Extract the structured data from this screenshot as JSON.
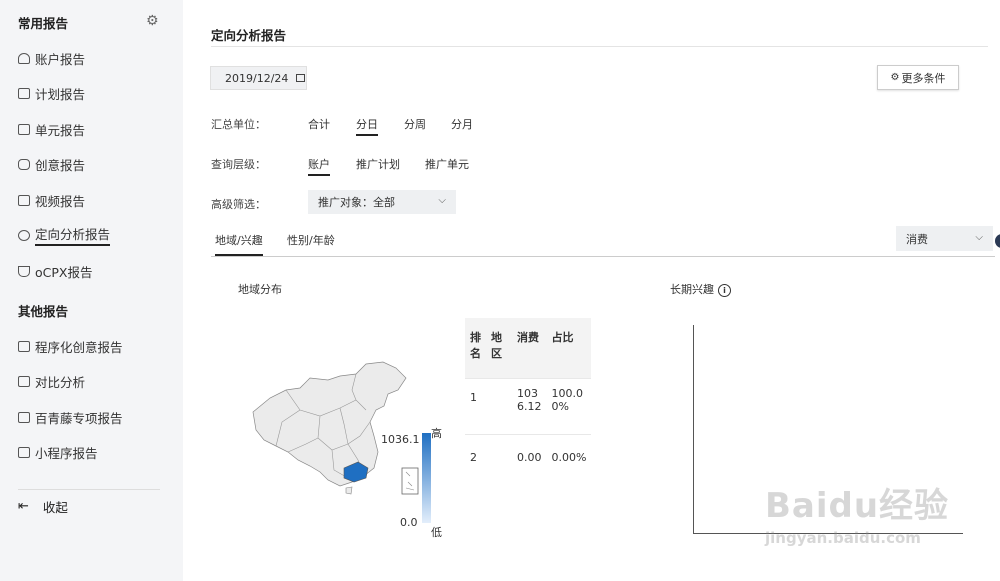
{
  "sidebar": {
    "common_title": "常用报告",
    "common_items": [
      {
        "label": "账户报告",
        "icon": "user-icon"
      },
      {
        "label": "计划报告",
        "icon": "plan-icon"
      },
      {
        "label": "单元报告",
        "icon": "unit-icon"
      },
      {
        "label": "创意报告",
        "icon": "creative-icon"
      },
      {
        "label": "视频报告",
        "icon": "video-icon"
      },
      {
        "label": "定向分析报告",
        "icon": "target-icon",
        "active": true
      },
      {
        "label": "oCPX报告",
        "icon": "ocpx-icon"
      }
    ],
    "other_title": "其他报告",
    "other_items": [
      {
        "label": "程序化创意报告",
        "icon": "programmatic-icon"
      },
      {
        "label": "对比分析",
        "icon": "compare-icon"
      },
      {
        "label": "百青藤专项报告",
        "icon": "report-icon"
      },
      {
        "label": "小程序报告",
        "icon": "miniprogram-icon"
      }
    ],
    "collapse_label": "收起"
  },
  "header": {
    "title": "定向分析报告"
  },
  "date": {
    "value": "2019/12/24"
  },
  "more_conditions": "更多条件",
  "filters": {
    "unit_label": "汇总单位：",
    "unit_options": [
      "合计",
      "分日",
      "分周",
      "分月"
    ],
    "unit_selected": "分日",
    "level_label": "查询层级：",
    "level_options": [
      "账户",
      "推广计划",
      "推广单元"
    ],
    "level_selected": "账户",
    "advanced_label": "高级筛选：",
    "advanced_value": "推广对象：全部"
  },
  "tabs": [
    "地域/兴趣",
    "性别/年龄"
  ],
  "metric_select": "消费",
  "region": {
    "title": "地域分布",
    "legend_high": "高",
    "legend_low": "低",
    "legend_max": "1036.1",
    "legend_min": "0.0",
    "table": {
      "headers": [
        "排名",
        "地区",
        "消费",
        "占比"
      ],
      "rows": [
        {
          "rank": "1",
          "region": "",
          "cost": "1036.12",
          "share": "100.00%"
        },
        {
          "rank": "2",
          "region": "",
          "cost": "0.00",
          "share": "0.00%"
        }
      ]
    }
  },
  "interest": {
    "title": "长期兴趣"
  },
  "watermark": {
    "logo": "Baidu经验",
    "url": "jingyan.baidu.com"
  },
  "colors": {
    "accent": "#1f6fc2",
    "sidebar_bg": "#f4f5f7"
  }
}
